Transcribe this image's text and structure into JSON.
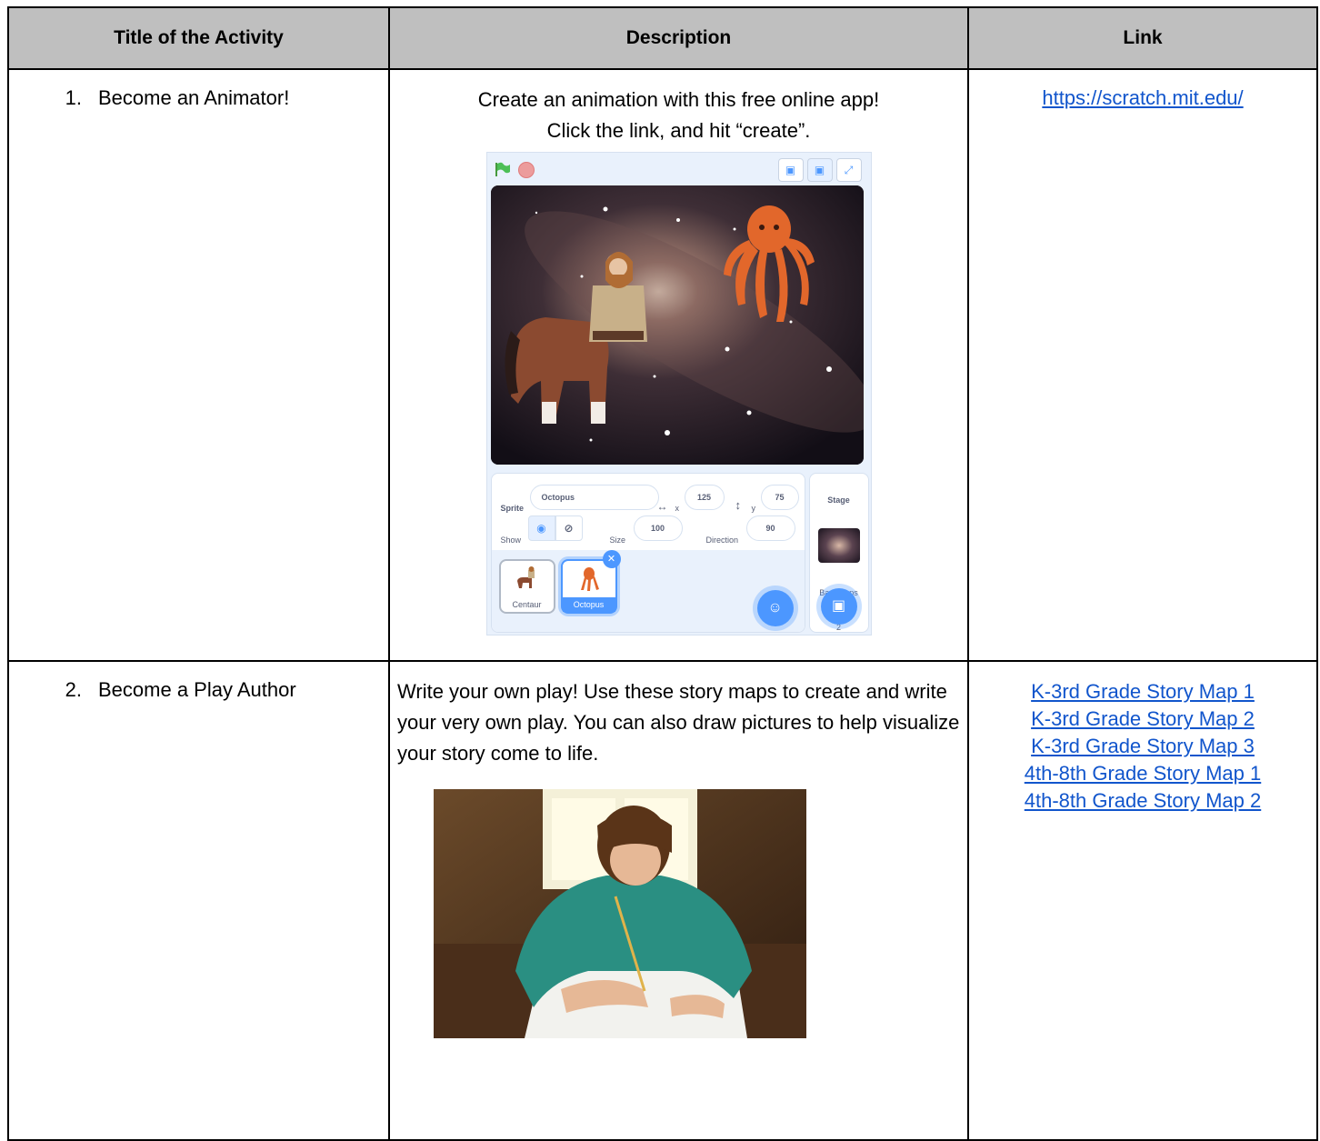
{
  "headers": {
    "title": "Title of the Activity",
    "description": "Description",
    "link": "Link"
  },
  "rows": [
    {
      "num": "1.",
      "title": "Become an Animator!",
      "description_line1": "Create an animation with this free online app!",
      "description_line2": "Click the link, and hit “create”.",
      "links": [
        "https://scratch.mit.edu/"
      ],
      "scratch": {
        "sprite_label": "Sprite",
        "sprite_name": "Octopus",
        "x_label": "x",
        "x_value": "125",
        "y_label": "y",
        "y_value": "75",
        "show_label": "Show",
        "size_label": "Size",
        "size_value": "100",
        "direction_label": "Direction",
        "direction_value": "90",
        "stage_label": "Stage",
        "backdrops_label": "Backdrops",
        "backdrops_count": "2",
        "sprites": [
          "Centaur",
          "Octopus"
        ]
      }
    },
    {
      "num": "2.",
      "title": "Become a Play Author",
      "description": "Write your own play! Use these story maps to create and write your very own play. You can also draw pictures to help visualize your story come to life.",
      "links": [
        "K-3rd Grade Story Map 1",
        "K-3rd Grade Story Map 2",
        "K-3rd Grade Story Map 3",
        "4th-8th Grade Story Map 1",
        "4th-8th Grade Story Map 2"
      ]
    }
  ],
  "colors": {
    "header_bg": "#bfbfbf",
    "link": "#1155cc",
    "scratch_blue": "#4c97ff"
  }
}
